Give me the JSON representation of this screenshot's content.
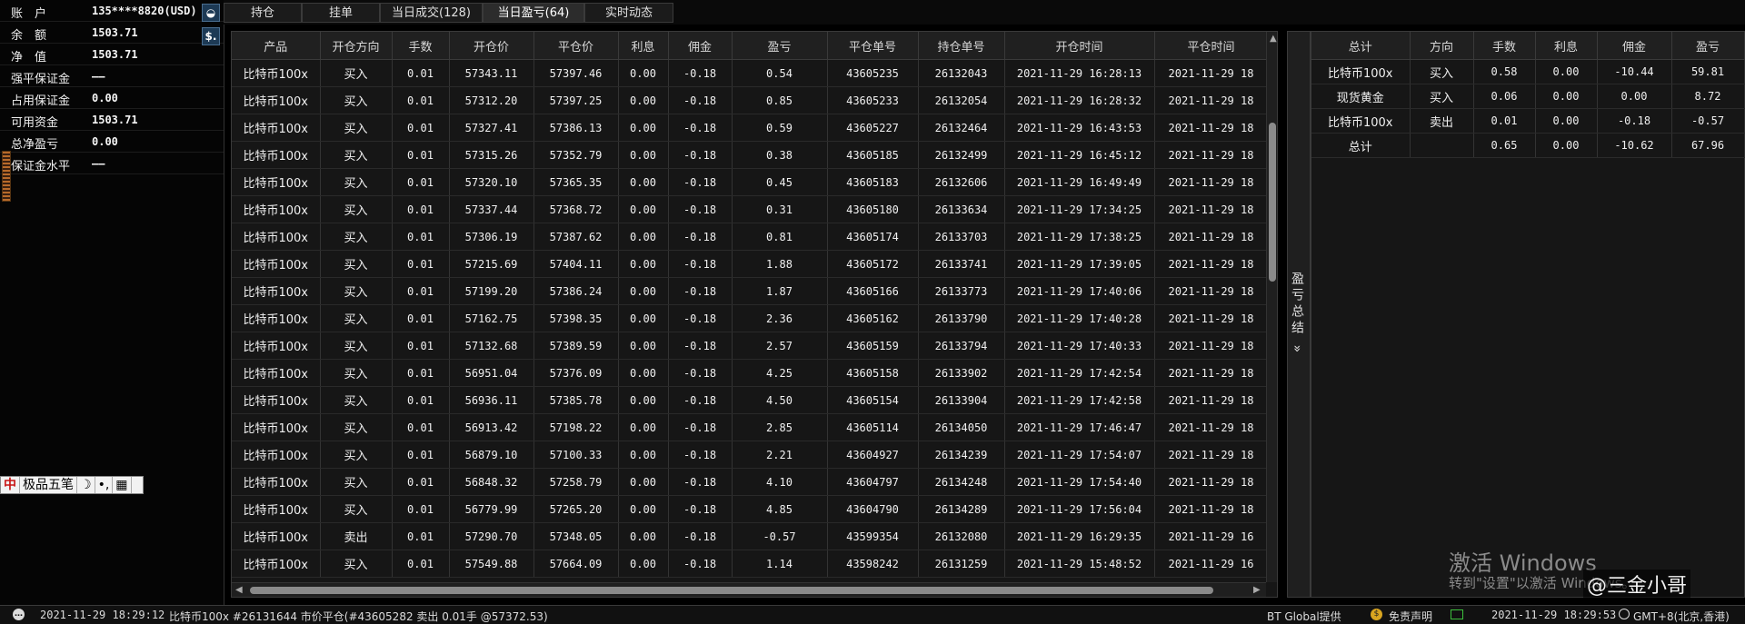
{
  "account": {
    "rows": [
      {
        "label": "账　户",
        "value": "135****8820(USD)"
      },
      {
        "label": "余　额",
        "value": "1503.71"
      },
      {
        "label": "净　值",
        "value": "1503.71"
      },
      {
        "label": "强平保证金",
        "value": "——"
      },
      {
        "label": "占用保证金",
        "value": "0.00"
      },
      {
        "label": "可用资金",
        "value": "1503.71"
      },
      {
        "label": "总净盈亏",
        "value": "0.00"
      },
      {
        "label": "保证金水平",
        "value": "——"
      }
    ],
    "icons": {
      "mask": "mask-icon",
      "dollar": "$."
    }
  },
  "ime": {
    "logo": "中",
    "name": "极品五笔",
    "moon": "☽",
    "punct": "•,",
    "keyboard": "▦"
  },
  "tabs": [
    {
      "label": "持仓",
      "active": false
    },
    {
      "label": "挂单",
      "active": false
    },
    {
      "label": "当日成交(128)",
      "active": false
    },
    {
      "label": "当日盈亏(64)",
      "active": true
    },
    {
      "label": "实时动态",
      "active": false
    }
  ],
  "table": {
    "columns": [
      "产品",
      "开仓方向",
      "手数",
      "开仓价",
      "平仓价",
      "利息",
      "佣金",
      "盈亏",
      "平仓单号",
      "持仓单号",
      "开仓时间",
      "平仓时间"
    ],
    "rows": [
      [
        "比特币100x",
        "买入",
        "0.01",
        "57343.11",
        "57397.46",
        "0.00",
        "-0.18",
        "0.54",
        "43605235",
        "26132043",
        "2021-11-29 16:28:13",
        "2021-11-29 18"
      ],
      [
        "比特币100x",
        "买入",
        "0.01",
        "57312.20",
        "57397.25",
        "0.00",
        "-0.18",
        "0.85",
        "43605233",
        "26132054",
        "2021-11-29 16:28:32",
        "2021-11-29 18"
      ],
      [
        "比特币100x",
        "买入",
        "0.01",
        "57327.41",
        "57386.13",
        "0.00",
        "-0.18",
        "0.59",
        "43605227",
        "26132464",
        "2021-11-29 16:43:53",
        "2021-11-29 18"
      ],
      [
        "比特币100x",
        "买入",
        "0.01",
        "57315.26",
        "57352.79",
        "0.00",
        "-0.18",
        "0.38",
        "43605185",
        "26132499",
        "2021-11-29 16:45:12",
        "2021-11-29 18"
      ],
      [
        "比特币100x",
        "买入",
        "0.01",
        "57320.10",
        "57365.35",
        "0.00",
        "-0.18",
        "0.45",
        "43605183",
        "26132606",
        "2021-11-29 16:49:49",
        "2021-11-29 18"
      ],
      [
        "比特币100x",
        "买入",
        "0.01",
        "57337.44",
        "57368.72",
        "0.00",
        "-0.18",
        "0.31",
        "43605180",
        "26133634",
        "2021-11-29 17:34:25",
        "2021-11-29 18"
      ],
      [
        "比特币100x",
        "买入",
        "0.01",
        "57306.19",
        "57387.62",
        "0.00",
        "-0.18",
        "0.81",
        "43605174",
        "26133703",
        "2021-11-29 17:38:25",
        "2021-11-29 18"
      ],
      [
        "比特币100x",
        "买入",
        "0.01",
        "57215.69",
        "57404.11",
        "0.00",
        "-0.18",
        "1.88",
        "43605172",
        "26133741",
        "2021-11-29 17:39:05",
        "2021-11-29 18"
      ],
      [
        "比特币100x",
        "买入",
        "0.01",
        "57199.20",
        "57386.24",
        "0.00",
        "-0.18",
        "1.87",
        "43605166",
        "26133773",
        "2021-11-29 17:40:06",
        "2021-11-29 18"
      ],
      [
        "比特币100x",
        "买入",
        "0.01",
        "57162.75",
        "57398.35",
        "0.00",
        "-0.18",
        "2.36",
        "43605162",
        "26133790",
        "2021-11-29 17:40:28",
        "2021-11-29 18"
      ],
      [
        "比特币100x",
        "买入",
        "0.01",
        "57132.68",
        "57389.59",
        "0.00",
        "-0.18",
        "2.57",
        "43605159",
        "26133794",
        "2021-11-29 17:40:33",
        "2021-11-29 18"
      ],
      [
        "比特币100x",
        "买入",
        "0.01",
        "56951.04",
        "57376.09",
        "0.00",
        "-0.18",
        "4.25",
        "43605158",
        "26133902",
        "2021-11-29 17:42:54",
        "2021-11-29 18"
      ],
      [
        "比特币100x",
        "买入",
        "0.01",
        "56936.11",
        "57385.78",
        "0.00",
        "-0.18",
        "4.50",
        "43605154",
        "26133904",
        "2021-11-29 17:42:58",
        "2021-11-29 18"
      ],
      [
        "比特币100x",
        "买入",
        "0.01",
        "56913.42",
        "57198.22",
        "0.00",
        "-0.18",
        "2.85",
        "43605114",
        "26134050",
        "2021-11-29 17:46:47",
        "2021-11-29 18"
      ],
      [
        "比特币100x",
        "买入",
        "0.01",
        "56879.10",
        "57100.33",
        "0.00",
        "-0.18",
        "2.21",
        "43604927",
        "26134239",
        "2021-11-29 17:54:07",
        "2021-11-29 18"
      ],
      [
        "比特币100x",
        "买入",
        "0.01",
        "56848.32",
        "57258.79",
        "0.00",
        "-0.18",
        "4.10",
        "43604797",
        "26134248",
        "2021-11-29 17:54:40",
        "2021-11-29 18"
      ],
      [
        "比特币100x",
        "买入",
        "0.01",
        "56779.99",
        "57265.20",
        "0.00",
        "-0.18",
        "4.85",
        "43604790",
        "26134289",
        "2021-11-29 17:56:04",
        "2021-11-29 18"
      ],
      [
        "比特币100x",
        "卖出",
        "0.01",
        "57290.70",
        "57348.05",
        "0.00",
        "-0.18",
        "-0.57",
        "43599354",
        "26132080",
        "2021-11-29 16:29:35",
        "2021-11-29 16"
      ],
      [
        "比特币100x",
        "买入",
        "0.01",
        "57549.88",
        "57664.09",
        "0.00",
        "-0.18",
        "1.14",
        "43598242",
        "26131259",
        "2021-11-29 15:48:52",
        "2021-11-29 16"
      ]
    ]
  },
  "summary": {
    "toggle_label": "盈亏总结 »",
    "columns": [
      "总计",
      "方向",
      "手数",
      "利息",
      "佣金",
      "盈亏"
    ],
    "rows": [
      [
        "比特币100x",
        "买入",
        "0.58",
        "0.00",
        "-10.44",
        "59.81"
      ],
      [
        "现货黄金",
        "买入",
        "0.06",
        "0.00",
        "0.00",
        "8.72"
      ],
      [
        "比特币100x",
        "卖出",
        "0.01",
        "0.00",
        "-0.18",
        "-0.57"
      ],
      [
        "总计",
        "",
        "0.65",
        "0.00",
        "-10.62",
        "67.96"
      ]
    ]
  },
  "watermark": {
    "title": "激活 Windows",
    "subtitle": "转到\"设置\"以激活 Windows。",
    "author": "@三金小哥"
  },
  "status": {
    "left_time": "2021-11-29 18:29:12",
    "message": "比特币100x #26131644 市价平仓(#43605282 卖出 0.01手 @57372.53)",
    "provider": "BT Global提供",
    "disclaimer": "免责声明",
    "right_time": "2021-11-29 18:29:53",
    "timezone": "GMT+8(北京,香港)"
  },
  "colors": {
    "profit": "#e03a3a",
    "loss": "#3cc03c"
  }
}
